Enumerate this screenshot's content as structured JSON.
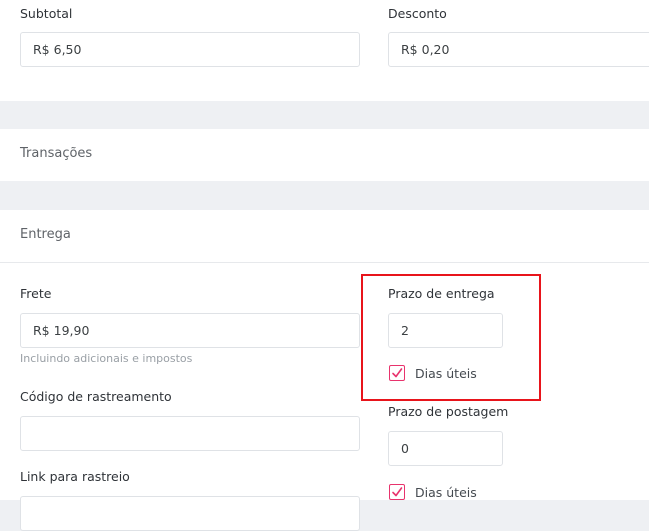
{
  "summary": {
    "subtotal_label": "Subtotal",
    "subtotal_value": "R$ 6,50",
    "discount_label": "Desconto",
    "discount_value": "R$ 0,20"
  },
  "transactions": {
    "title": "Transações"
  },
  "delivery": {
    "title": "Entrega",
    "shipping_label": "Frete",
    "shipping_value": "R$ 19,90",
    "shipping_helper": "Incluindo adicionais e impostos",
    "tracking_code_label": "Código de rastreamento",
    "tracking_code_value": "",
    "tracking_link_label": "Link para rastreio",
    "delivery_time_label": "Prazo de entrega",
    "delivery_time_value": "2",
    "delivery_business_days_label": "Dias úteis",
    "delivery_business_days_checked": true,
    "posting_time_label": "Prazo de postagem",
    "posting_time_value": "0",
    "posting_business_days_label": "Dias úteis",
    "posting_business_days_checked": true
  },
  "colors": {
    "checkbox_accent": "#e8336d",
    "highlight_border": "#e8141b",
    "page_background": "#eef0f3"
  },
  "icons": {
    "checkbox_checked": "checkmark-icon"
  }
}
